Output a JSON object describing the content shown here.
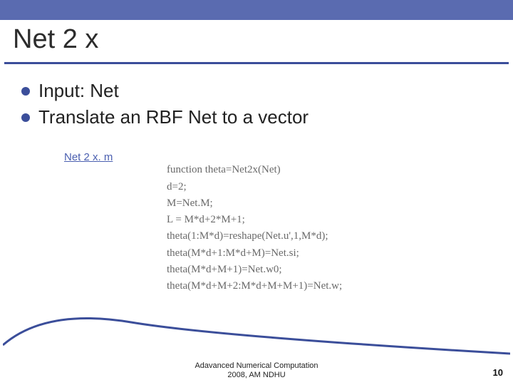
{
  "title": "Net 2 x",
  "bullets": [
    "Input: Net",
    "Translate an RBF Net to a vector"
  ],
  "link_label": "Net 2 x. m",
  "code": {
    "l1": "function theta=Net2x(Net)",
    "l2": "d=2;",
    "l3": "M=Net.M;",
    "l4": "L = M*d+2*M+1;",
    "l5": "theta(1:M*d)=reshape(Net.u',1,M*d);",
    "l6": "theta(M*d+1:M*d+M)=Net.si;",
    "l7": "theta(M*d+M+1)=Net.w0;",
    "l8": "theta(M*d+M+2:M*d+M+M+1)=Net.w;"
  },
  "footer": {
    "line1": "Adavanced Numerical Computation",
    "line2": "2008, AM NDHU"
  },
  "page_number": "10"
}
